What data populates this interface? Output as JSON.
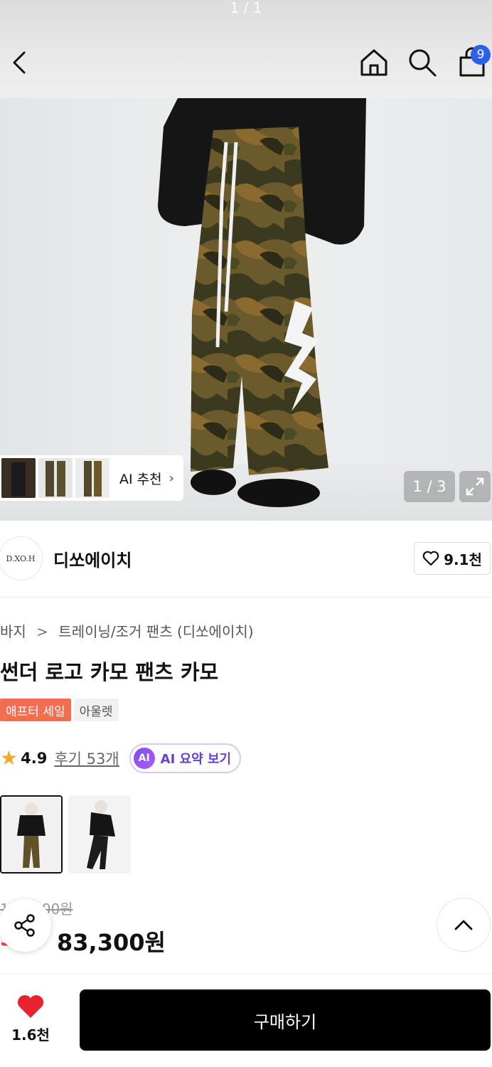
{
  "status": {
    "page_indicator": "1 / 1"
  },
  "header": {
    "cart_count": "9"
  },
  "hero": {
    "counter": "1 / 3",
    "ai_recommend_label": "AI 추천",
    "ai_recommend_chevron": "›"
  },
  "brand": {
    "logo_text": "D.XO.H",
    "name": "디쏘에이치",
    "likes": "9.1천"
  },
  "product": {
    "breadcrumb": [
      "바지",
      "트레이닝/조거 팬츠 (디쏘에이치)"
    ],
    "breadcrumb_sep": ">",
    "title": "썬더 로고 카모 팬츠 카모",
    "badges": {
      "sale": "애프터 세일",
      "outlet": "아울렛"
    },
    "rating": "4.9",
    "reviews": "후기 53개",
    "ai_summary_icon": "AI",
    "ai_summary_label": "AI 요약 보기",
    "original_price": "1",
    "original_price_tail": "00원",
    "discount": "3",
    "price": "83,300원"
  },
  "bottom_bar": {
    "wishlist_count": "1.6천",
    "buy_label": "구매하기"
  },
  "colors": {
    "accent_blue": "#2a61e6",
    "sale_badge": "#f26d52",
    "discount_red": "#f0453a",
    "heart_red": "#e8222e",
    "ai_purple": "#6a3fd6",
    "buy_button": "#000000"
  },
  "icons": [
    "back-arrow-icon",
    "home-icon",
    "search-icon",
    "shopping-bag-icon",
    "expand-icon",
    "heart-outline-icon",
    "star-icon",
    "share-icon",
    "chevron-up-icon",
    "heart-filled-icon"
  ]
}
